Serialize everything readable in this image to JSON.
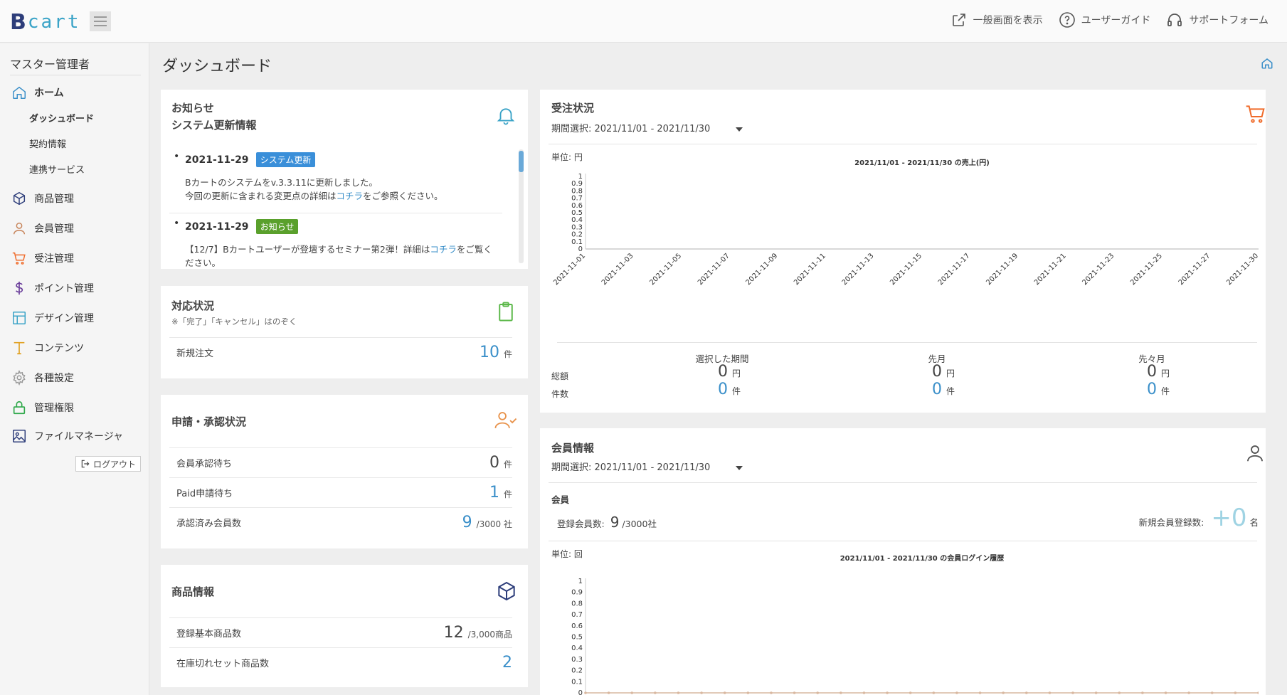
{
  "app": {
    "logo_text": "cart",
    "logo_letter": "B",
    "nav": [
      {
        "label": "一般画面を表示",
        "icon": "external-link-icon"
      },
      {
        "label": "ユーザーガイド",
        "icon": "question-circle-icon"
      },
      {
        "label": "サポートフォーム",
        "icon": "headset-icon"
      }
    ]
  },
  "sidebar": {
    "title": "マスター管理者",
    "items": [
      {
        "label": "ホーム",
        "icon": "home-icon"
      },
      {
        "label": "商品管理",
        "icon": "box-icon"
      },
      {
        "label": "会員管理",
        "icon": "user-icon"
      },
      {
        "label": "受注管理",
        "icon": "cart-icon"
      },
      {
        "label": "ポイント管理",
        "icon": "dollar-icon"
      },
      {
        "label": "デザイン管理",
        "icon": "layout-icon"
      },
      {
        "label": "コンテンツ",
        "icon": "text-t-icon"
      },
      {
        "label": "各種設定",
        "icon": "gear-icon"
      },
      {
        "label": "管理権限",
        "icon": "lock-icon"
      },
      {
        "label": "ファイルマネージャ",
        "icon": "image-icon"
      }
    ],
    "sub_items": [
      "ダッシュボード",
      "契約情報",
      "連携サービス"
    ],
    "logout": "ログアウト"
  },
  "page": {
    "title": "ダッシュボード"
  },
  "news": {
    "title1": "お知らせ",
    "title2": "システム更新情報",
    "items": [
      {
        "date": "2021-11-29",
        "badge": "システム更新",
        "badge_color": "#3a8fd9",
        "line1": "Bカートのシステムをv.3.3.11に更新しました。",
        "line2_pre": "今回の更新に含まれる変更点の詳細は",
        "line2_link": "コチラ",
        "line2_post": "をご参照ください。"
      },
      {
        "date": "2021-11-29",
        "badge": "お知らせ",
        "badge_color": "#5aa02c",
        "line1_pre": "【12/7】Bカートユーザーが登壇するセミナー第2弾！詳細は",
        "line1_link": "コチラ",
        "line1_post": "をご覧く",
        "line2": "ださい。"
      }
    ]
  },
  "status": {
    "title": "対応状況",
    "note": "※「完了」「キャンセル」はのぞく",
    "rows": [
      {
        "label": "新規注文",
        "value": "10",
        "unit": "件"
      }
    ]
  },
  "approval": {
    "title": "申請・承認状況",
    "rows": [
      {
        "label": "会員承認待ち",
        "value": "0",
        "unit": "件"
      },
      {
        "label": "Paid申請待ち",
        "value": "1",
        "unit": "件"
      },
      {
        "label": "承認済み会員数",
        "value": "9",
        "unit": "/3000 社"
      }
    ]
  },
  "product": {
    "title": "商品情報",
    "rows": [
      {
        "label": "登録基本商品数",
        "value": "12",
        "unit": "/3,000商品"
      },
      {
        "label": "在庫切れセット商品数",
        "value": "2",
        "unit": ""
      }
    ]
  },
  "orders": {
    "title": "受注状況",
    "period": "期間選択:  2021/11/01 - 2021/11/30",
    "unit_label": "単位: 円",
    "summary_heads": [
      "選択した期間",
      "先月",
      "先々月"
    ],
    "row_labels": [
      "総額",
      "件数"
    ],
    "totals": [
      {
        "value": "0",
        "unit": "円"
      },
      {
        "value": "0",
        "unit": "円"
      },
      {
        "value": "0",
        "unit": "円"
      }
    ],
    "counts": [
      {
        "value": "0",
        "unit": "件"
      },
      {
        "value": "0",
        "unit": "件"
      },
      {
        "value": "0",
        "unit": "件"
      }
    ]
  },
  "members": {
    "title": "会員情報",
    "period": "期間選択:  2021/11/01 - 2021/11/30",
    "section": "会員",
    "registered_label": "登録会員数:",
    "registered_value": "9",
    "registered_unit": "/3000社",
    "new_label": "新規会員登録数:",
    "new_value": "+0",
    "new_unit": "名",
    "unit_label": "単位: 回"
  },
  "chart_data": [
    {
      "type": "line",
      "title": "2021/11/01 - 2021/11/30 の売上(円)",
      "x": [
        "2021-11-01",
        "2021-11-03",
        "2021-11-05",
        "2021-11-07",
        "2021-11-09",
        "2021-11-11",
        "2021-11-13",
        "2021-11-15",
        "2021-11-17",
        "2021-11-19",
        "2021-11-21",
        "2021-11-23",
        "2021-11-25",
        "2021-11-27",
        "2021-11-30"
      ],
      "series": [
        {
          "values": [
            0,
            0,
            0,
            0,
            0,
            0,
            0,
            0,
            0,
            0,
            0,
            0,
            0,
            0,
            0
          ]
        }
      ],
      "yticks": [
        "1",
        "0.9",
        "0.8",
        "0.7",
        "0.6",
        "0.5",
        "0.4",
        "0.3",
        "0.2",
        "0.1",
        "0"
      ],
      "ylim": [
        0,
        1
      ],
      "line_color": "#cccccc"
    },
    {
      "type": "line",
      "title": "2021/11/01 - 2021/11/30 の会員ログイン履歴",
      "series": [
        {
          "values": [
            0,
            0,
            0,
            0,
            0,
            0,
            0,
            0,
            0,
            0,
            0,
            0,
            0,
            0,
            0,
            0,
            0,
            0,
            0,
            0,
            0,
            0,
            0,
            0,
            0,
            0,
            0,
            0,
            0,
            0
          ]
        }
      ],
      "yticks": [
        "1",
        "0.9",
        "0.8",
        "0.7",
        "0.6",
        "0.5",
        "0.4",
        "0.3",
        "0.2",
        "0.1",
        "0"
      ],
      "ylim": [
        0,
        1
      ],
      "line_color": "#d9b8a0"
    }
  ],
  "colors": {
    "accent_blue": "#3a8fc9",
    "cart_orange": "#f06b2a",
    "bell_blue": "#3aa3c7",
    "clipboard_green": "#5cb84a"
  }
}
